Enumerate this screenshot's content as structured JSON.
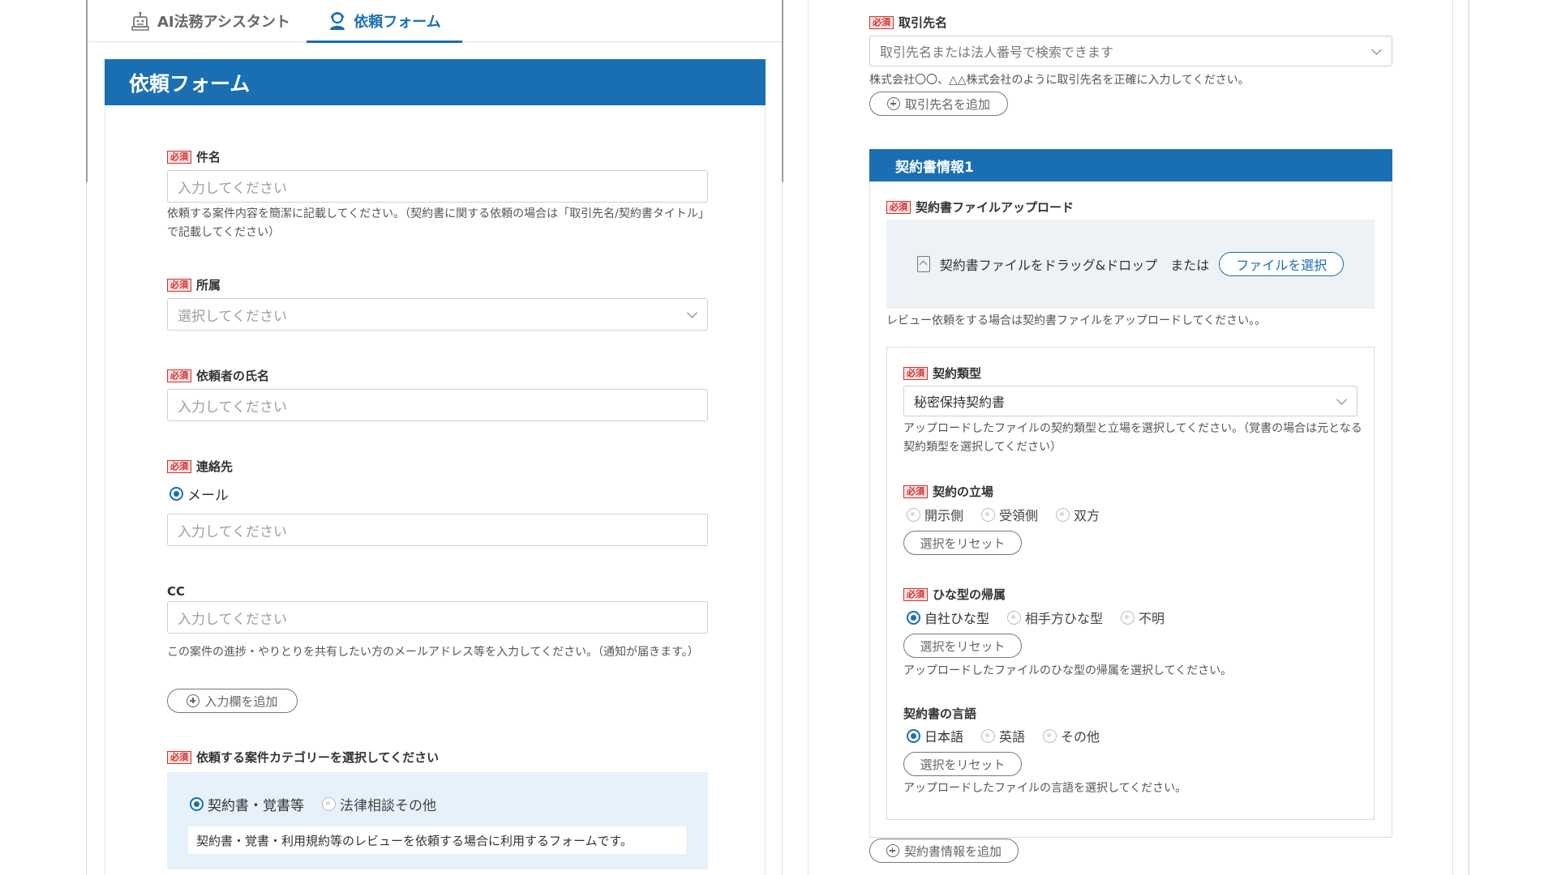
{
  "tabs": [
    {
      "label": "AI法務アシスタント",
      "icon": "robot-icon"
    },
    {
      "label": "依頼フォーム",
      "icon": "person-icon",
      "active": true
    }
  ],
  "form": {
    "title": "依頼フォーム",
    "required_label": "必須",
    "subject": {
      "label": "件名",
      "placeholder": "入力してください",
      "help": "依頼する案件内容を簡潔に記載してください。（契約書に関する依頼の場合は「取引先名/契約書タイトル」で記載してください）"
    },
    "department": {
      "label": "所属",
      "placeholder": "選択してください"
    },
    "requester": {
      "label": "依頼者の氏名",
      "placeholder": "入力してください"
    },
    "contact": {
      "label": "連絡先",
      "option": "メール",
      "placeholder": "入力してください"
    },
    "cc": {
      "label": "CC",
      "placeholder": "入力してください",
      "help": "この案件の進捗・やりとりを共有したい方のメールアドレス等を入力してください。（通知が届きます。）",
      "add_label": "入力欄を追加"
    },
    "category": {
      "label": "依頼する案件カテゴリーを選択してください",
      "options": [
        "契約書・覚書等",
        "法律相談その他"
      ],
      "selected": "契約書・覚書等",
      "description": "契約書・覚書・利用規約等のレビューを依頼する場合に利用するフォームです。"
    }
  },
  "right": {
    "client": {
      "label": "取引先名",
      "placeholder": "取引先名または法人番号で検索できます",
      "help": "株式会社〇〇、△△株式会社のように取引先名を正確に入力してください。",
      "add_label": "取引先名を追加"
    },
    "contract_section": {
      "title": "契約書情報1",
      "upload": {
        "label": "契約書ファイルアップロード",
        "drop_text": "契約書ファイルをドラッグ&ドロップ　または",
        "button": "ファイルを選択",
        "help": "レビュー依頼をする場合は契約書ファイルをアップロードしてください。。"
      },
      "contract_type": {
        "label": "契約類型",
        "value": "秘密保持契約書",
        "help": "アップロードしたファイルの契約類型と立場を選択してください。（覚書の場合は元となる契約類型を選択してください）"
      },
      "position": {
        "label": "契約の立場",
        "options": [
          "開示側",
          "受領側",
          "双方"
        ],
        "reset": "選択をリセット"
      },
      "template": {
        "label": "ひな型の帰属",
        "options": [
          "自社ひな型",
          "相手方ひな型",
          "不明"
        ],
        "selected": "自社ひな型",
        "reset": "選択をリセット",
        "help": "アップロードしたファイルのひな型の帰属を選択してください。"
      },
      "language": {
        "label": "契約書の言語",
        "options": [
          "日本語",
          "英語",
          "その他"
        ],
        "selected": "日本語",
        "reset": "選択をリセット",
        "help": "アップロードしたファイルの言語を選択してください。"
      }
    },
    "add_contract_label": "契約書情報を追加"
  }
}
